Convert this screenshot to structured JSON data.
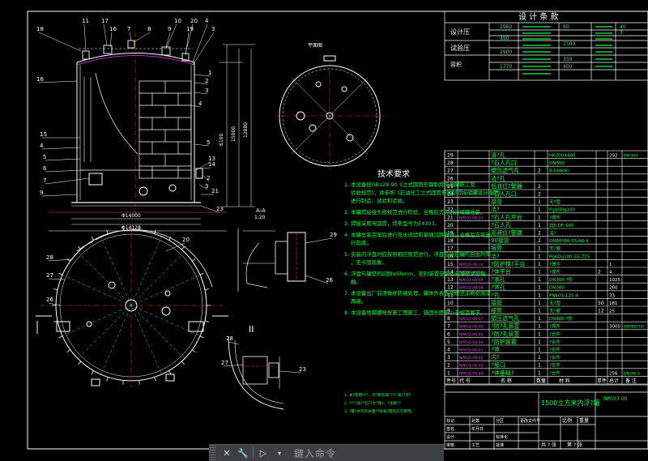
{
  "design_table": {
    "title": "设 计 条 款",
    "rows": [
      "设计压",
      "试验压",
      "容积",
      "介质",
      "工作温度",
      "腐蚀余量",
      "设计寿命"
    ],
    "cells": [
      "1960",
      "490",
      "2900",
      "1770",
      "60",
      "1500",
      "350",
      "400",
      "40",
      "3"
    ]
  },
  "parts_table": {
    "rows": [
      {
        "no": "29",
        "code": "",
        "name": "清?孔",
        "qty": "",
        "spec": "HK300X400",
        "mat": "",
        "num": "292",
        "note": "DN-300"
      },
      {
        "no": "28",
        "code": "",
        "name": "?石人孔口",
        "qty": "",
        "spec": "DN600",
        "mat": "",
        "num": "",
        "note": ""
      },
      {
        "no": "27",
        "code": "",
        "name": "塑压透气孔",
        "qty": "2",
        "spec": "B-DN600",
        "mat": "",
        "num": "",
        "note": ""
      },
      {
        "no": "26",
        "code": "",
        "name": "清?孔",
        "qty": "",
        "spec": "",
        "mat": "",
        "num": "",
        "note": ""
      },
      {
        "no": "25",
        "code": "",
        "name": "低液位?警器",
        "qty": "2",
        "spec": "",
        "mat": "",
        "num": "",
        "note": ""
      },
      {
        "no": "24",
        "code": "",
        "name": "?石人孔口",
        "qty": "2",
        "spec": "",
        "mat": "",
        "num": "",
        "note": ""
      },
      {
        "no": "23",
        "code": "",
        "name": "接管",
        "qty": "1",
        "spec": "无?管",
        "mat": "",
        "num": "",
        "note": ""
      },
      {
        "no": "22",
        "code": "",
        "name": "法?",
        "qty": "1",
        "spec": "Pg10Dg100",
        "mat": "",
        "num": "",
        "note": ""
      },
      {
        "no": "21",
        "code": "NP033-00-13",
        "name": "?石人孔平台",
        "qty": "1",
        "spec": "?焊件",
        "mat": "",
        "num": "",
        "note": ""
      },
      {
        "no": "20",
        "code": "",
        "name": "?石人孔",
        "qty": "1",
        "spec": "ZJ5 DF-500",
        "mat": "",
        "num": "",
        "note": ""
      },
      {
        "no": "19",
        "code": "",
        "name": "高液位?警器",
        "qty": "2",
        "spec": "法?",
        "mat": "",
        "num": "",
        "note": ""
      },
      {
        "no": "18",
        "code": "",
        "name": "90接管",
        "qty": "2",
        "spec": "DN80*80-SS-A6.4",
        "mat": "",
        "num": "",
        "note": ""
      },
      {
        "no": "17",
        "code": "",
        "name": "接管",
        "qty": "1",
        "spec": "无?管",
        "mat": "",
        "num": "",
        "note": ""
      },
      {
        "no": "16",
        "code": "",
        "name": "法?",
        "qty": "1",
        "spec": "Pg6Dg100-SS-Z25",
        "mat": "",
        "num": "",
        "note": ""
      },
      {
        "no": "15",
        "code": "NP033-00-11",
        "name": "?防护梯?平台",
        "qty": "1",
        "spec": "?焊件",
        "mat": "",
        "num": "1",
        "note": ""
      },
      {
        "no": "14",
        "code": "NP033-00-10",
        "name": "?体平台",
        "qty": "1",
        "spec": "?焊件",
        "mat": "2",
        "num": "4",
        "note": ""
      },
      {
        "no": "13",
        "code": "NP033-00-09",
        "name": "?液孔",
        "qty": "1",
        "spec": "DN300 ?件",
        "mat": "",
        "num": "1025",
        "note": ""
      },
      {
        "no": "12",
        "code": "NP033-00-08",
        "name": "?体孔",
        "qty": "1",
        "spec": "DN300",
        "mat": "",
        "num": "260",
        "note": ""
      },
      {
        "no": "11",
        "code": "",
        "name": "?孔",
        "qty": "1",
        "spec": "PN40S-125-4",
        "mat": "",
        "num": "33",
        "note": ""
      },
      {
        "no": "10",
        "code": "",
        "name": "接管",
        "qty": "1",
        "spec": "无?管",
        "mat": "50",
        "num": "181",
        "note": ""
      },
      {
        "no": "9",
        "code": "",
        "name": "接管",
        "qty": "1",
        "spec": "无?管",
        "mat": "12",
        "num": "25",
        "note": ""
      },
      {
        "no": "8",
        "code": "NP033-00-07",
        "name": "塑压透气孔",
        "qty": "1",
        "spec": "DN800 ?件",
        "mat": "",
        "num": "",
        "note": ""
      },
      {
        "no": "7",
        "code": "NP033-00-06",
        "name": "?防?孔装置",
        "qty": "1",
        "spec": "?焊件",
        "mat": "",
        "num": "3000",
        "note": "DN780?78?"
      },
      {
        "no": "6",
        "code": "NP033-00-05",
        "name": "?防?孔装置",
        "qty": "1",
        "spec": "?合件",
        "mat": "",
        "num": "",
        "note": ""
      },
      {
        "no": "5",
        "code": "NP033-00-04",
        "name": "?防护装置",
        "qty": "1",
        "spec": "?合件",
        "mat": "",
        "num": "",
        "note": ""
      },
      {
        "no": "4",
        "code": "NP033-00-03",
        "name": "?体",
        "qty": "1",
        "spec": "?合件",
        "mat": "",
        "num": "",
        "note": ""
      },
      {
        "no": "3",
        "code": "NP033-00-02",
        "name": "内?",
        "qty": "1",
        "spec": "?合件",
        "mat": "",
        "num": "",
        "note": ""
      },
      {
        "no": "2",
        "code": "NP033-00-01",
        "name": "?接口",
        "qty": "1",
        "spec": "?合件",
        "mat": "",
        "num": "",
        "note": ""
      },
      {
        "no": "1",
        "code": "NP033-00-00",
        "name": "?体基础?",
        "qty": "1",
        "spec": "?合件",
        "mat": "",
        "num": "256",
        "note": "DN200-4"
      }
    ],
    "header": [
      "件号",
      "代 号",
      "名 称",
      "数量",
      "材 料",
      "单件",
      "总计",
      "备 注"
    ]
  },
  "title_block": {
    "title": "1500立方米内浮?罐",
    "drawing_no": "NP033-00",
    "scale_label": "比例",
    "weight_label": "重量",
    "sheet": "共 ? 张",
    "sheet2": "第 ? 张",
    "small_labels": [
      "标记",
      "处数",
      "分区",
      "更改文件号",
      "签名",
      "年月日",
      "设计",
      "标准化",
      "审核",
      "工艺",
      "批准"
    ]
  },
  "tech_requirements": {
    "heading": "技术要求",
    "items": [
      "1. 本设备按GB128-90《立式圆筒形钢制焊接油罐施工及验收规范》，并参照《石油化工立式圆筒形钢制焊接储罐设计规范》进行制造、试验和验收。",
      "2. 本罐焊接接头按规范进行检验，合格后方可进行储罐总装。",
      "3. 焊接采用电弧焊，焊条型号为E4303。",
      "4. 本罐总装完毕后进行充水试验和基础沉降观测，合格后方可进行防腐。",
      "5. 安装内浮盘时应按照相应规范进行，浮盘应能在罐内自由升降，无卡阻现象。",
      "6. 浮盘与罐壁的间隙≤50mm，密封装置安装应与罐壁紧密接触。",
      "7. 本设备出厂前须做好防锈处理，罐体外表面按规范涂刷防腐漆两道。",
      "8. 本设备地脚螺栓按施工图施工，锚固长度不小于规范要求。"
    ],
    "notes": [
      "1. 本?使用???，内?要求按???? 第??页?",
      "2. ????按??在??大?施?，?注意??",
      "3. ?罐?体内外表面??防腐?理后方可使用。"
    ]
  },
  "view_labels": {
    "top_view_title": "平面图",
    "section_aa": "A-A",
    "scale_aa": "1:20",
    "detail_II": "II",
    "left_dims": [
      "15000",
      "12880"
    ],
    "elevation_dims": [
      "6100",
      "Φ14000",
      "Φ14120"
    ]
  },
  "leaders_top": [
    "11",
    "17",
    "16",
    "7",
    "8",
    "9",
    "10",
    "20",
    "19",
    "4",
    "3"
  ],
  "leaders_left_elev": [
    "18",
    "16",
    "15",
    "4",
    "5",
    "6",
    "7",
    "9"
  ],
  "leaders_right_elev": [
    "1",
    "2",
    "3",
    "4",
    "5",
    "13",
    "14",
    "2",
    "3",
    "21",
    "23"
  ],
  "leaders_plan": [
    "28",
    "27",
    "26",
    "20"
  ],
  "leaders_detail": [
    "29",
    "26",
    "28",
    "27",
    "23"
  ],
  "command_bar": {
    "prompt": "鍵入命令"
  },
  "colors": {
    "background": "#000000",
    "green": "#00ff3f",
    "white": "#ffffff",
    "red": "#ff3030",
    "magenta": "#ff30ff",
    "cyan": "#00ffff",
    "yellow": "#ffff40"
  }
}
